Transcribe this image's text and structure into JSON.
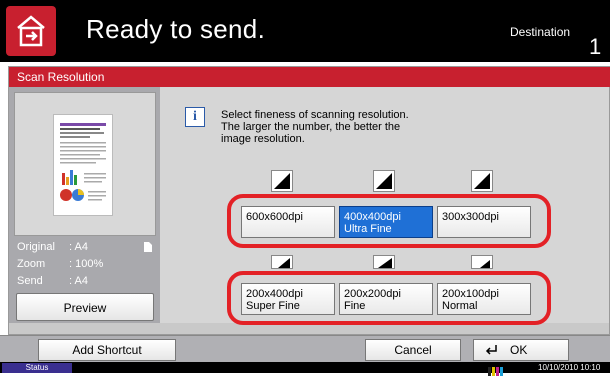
{
  "header": {
    "title": "Ready to send.",
    "destination_label": "Destination",
    "destination_count": "1"
  },
  "panel": {
    "title": "Scan Resolution"
  },
  "left": {
    "info": [
      {
        "key": "Original",
        "value": ": A4"
      },
      {
        "key": "Zoom",
        "value": ": 100%"
      },
      {
        "key": "Send",
        "value": ": A4"
      }
    ],
    "preview_label": "Preview"
  },
  "message": {
    "line1": "Select fineness of scanning resolution.",
    "line2": "The larger the number, the better the",
    "line3": "image resolution."
  },
  "resolutions": {
    "r1": {
      "line1": "600x600dpi",
      "line2": ""
    },
    "r2": {
      "line1": "400x400dpi",
      "line2": "Ultra Fine"
    },
    "r3": {
      "line1": "300x300dpi",
      "line2": ""
    },
    "r4": {
      "line1": "200x400dpi",
      "line2": "Super Fine"
    },
    "r5": {
      "line1": "200x200dpi",
      "line2": "Fine"
    },
    "r6": {
      "line1": "200x100dpi",
      "line2": "Normal"
    },
    "selected": "400x400dpi"
  },
  "footer": {
    "add_shortcut": "Add Shortcut",
    "cancel": "Cancel",
    "ok": "OK"
  },
  "status": {
    "label": "Status",
    "datetime": "10/10/2010 10:10"
  },
  "colors": {
    "accent_red": "#c8202f",
    "highlight_oval": "#e32126",
    "selected_blue": "#1f70d6"
  }
}
